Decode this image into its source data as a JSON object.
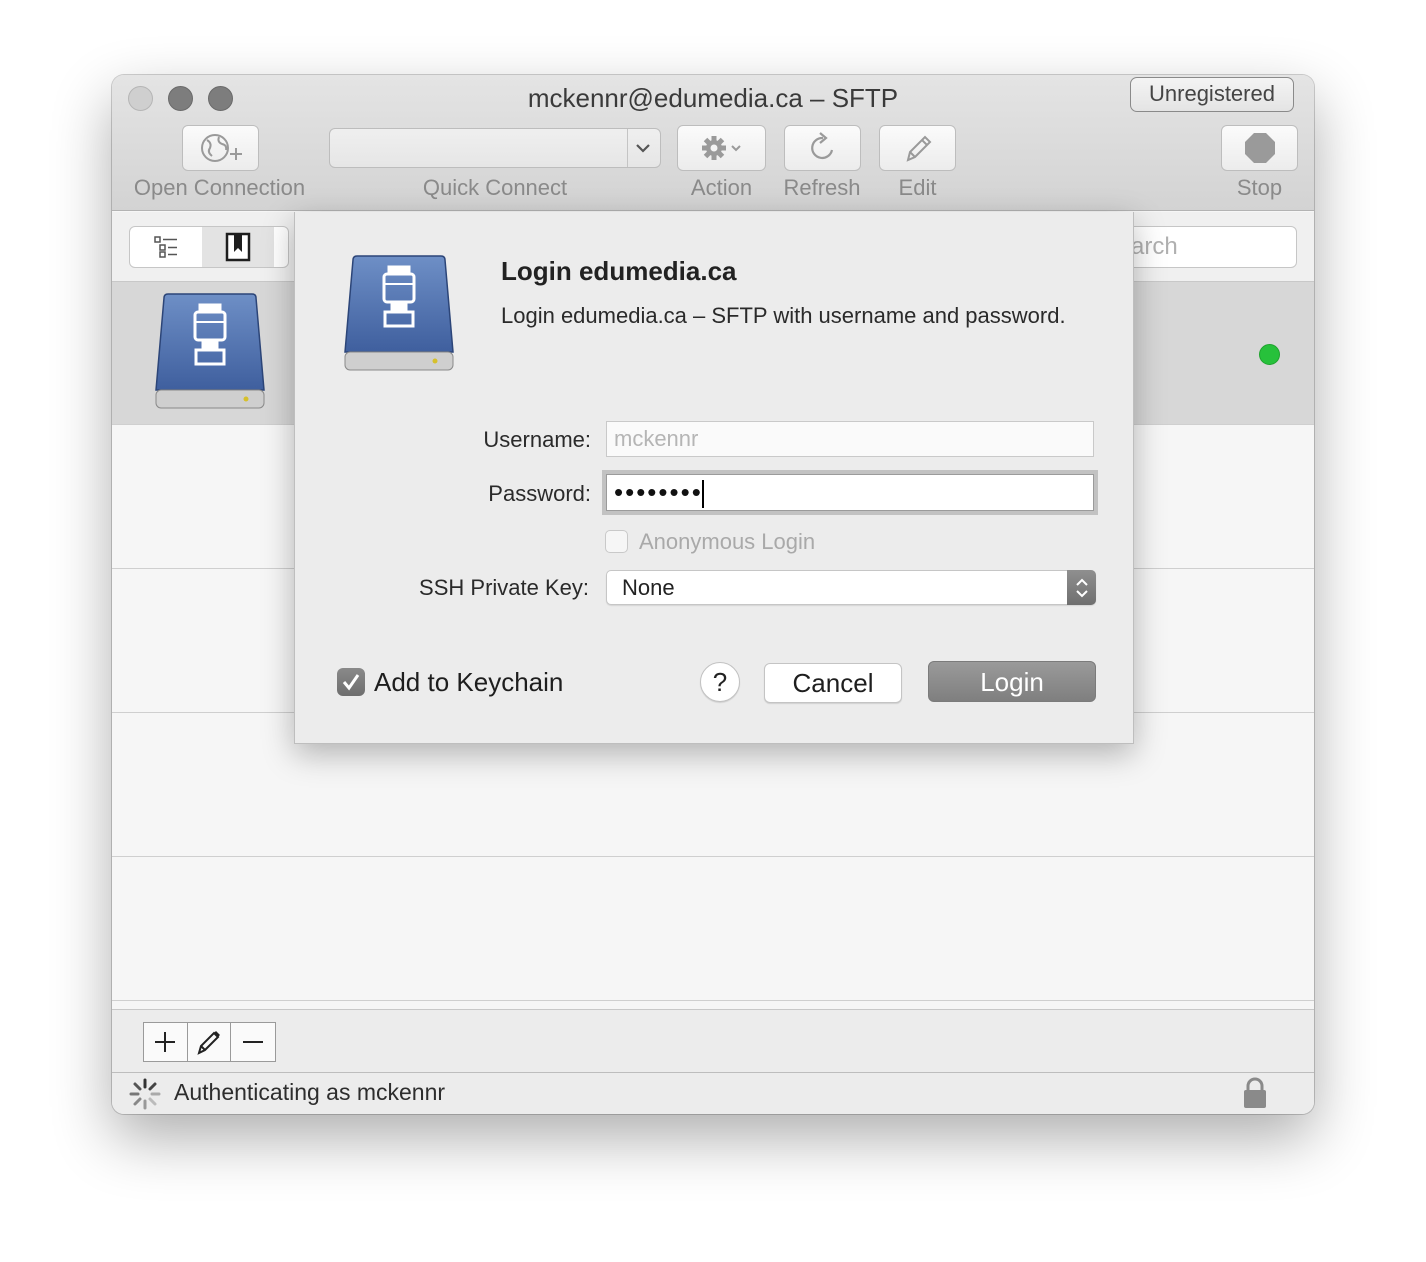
{
  "window": {
    "title": "mckennr@edumedia.ca – SFTP",
    "unregistered_label": "Unregistered"
  },
  "toolbar": {
    "open_connection_label": "Open Connection",
    "quick_connect_label": "Quick Connect",
    "quick_connect_value": "",
    "action_label": "Action",
    "refresh_label": "Refresh",
    "edit_label": "Edit",
    "stop_label": "Stop"
  },
  "subbar": {
    "search_visible_text": "arch"
  },
  "bookmarks": {
    "rows": [
      {
        "selected": true,
        "status": "connected",
        "status_color": "#27c13b"
      },
      {
        "selected": false
      },
      {
        "selected": false
      },
      {
        "selected": false
      },
      {
        "selected": false
      }
    ]
  },
  "status": {
    "text": "Authenticating as mckennr"
  },
  "login_sheet": {
    "title": "Login edumedia.ca",
    "message": "Login edumedia.ca – SFTP with username and password.",
    "username_label": "Username:",
    "username_value": "mckennr",
    "password_label": "Password:",
    "password_value": "••••••••",
    "anonymous_label": "Anonymous Login",
    "anonymous_checked": false,
    "ssh_key_label": "SSH Private Key:",
    "ssh_key_value": "None",
    "keychain_label": "Add to Keychain",
    "keychain_checked": true,
    "help_label": "?",
    "cancel_label": "Cancel",
    "login_label": "Login"
  },
  "icons": [
    "globe-plus-icon",
    "chevron-down-icon",
    "gear-icon",
    "refresh-icon",
    "pencil-icon",
    "stop-icon",
    "outline-icon",
    "bookmark-icon",
    "network-drive-icon",
    "plus-icon",
    "minus-icon",
    "spinner-icon",
    "lock-icon",
    "checkmark-icon",
    "updown-arrows-icon"
  ]
}
